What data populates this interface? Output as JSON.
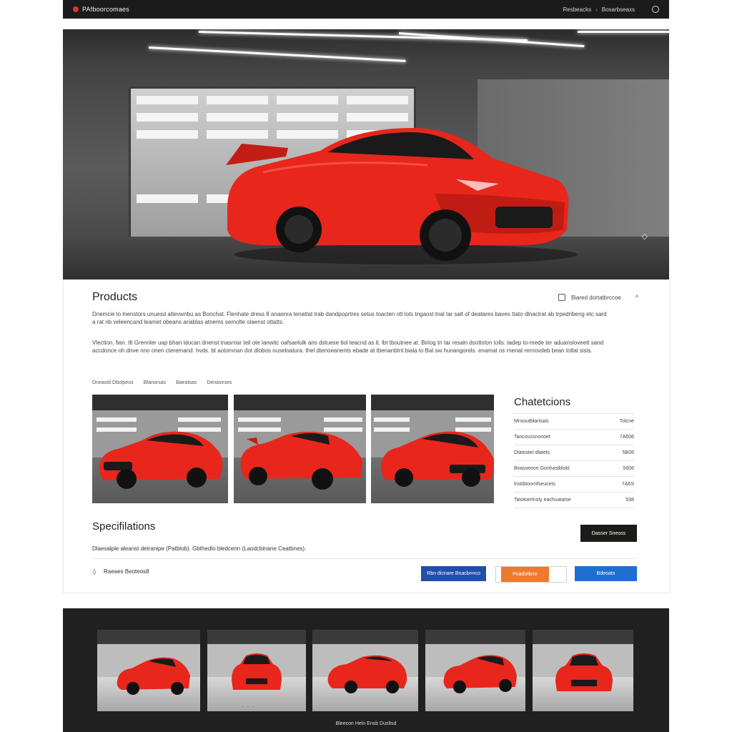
{
  "nav": {
    "brand": "PAfboorcomaes",
    "links": [
      "Resbeacks",
      "Bosarbseaxs"
    ],
    "separator": "›",
    "icons": {
      "logo": "logo-dot-icon",
      "search": "search-icon"
    }
  },
  "hero": {
    "nav_arrow": "◇"
  },
  "products": {
    "title": "Products",
    "filter_label": "Biared dortatbrccoe",
    "filter_chevron": "^",
    "para1": "Dnemcie lo lnenstors unuesd atlevwnbu as Bonchat. Flenhate dress 8 anaonra tenattat trab dandpoprtres setus toacten ott lots tngaost tnal tar salt of deatares baves ttato dlnaclrat ab trpedribeng etc sard a rat nb veleencand leamet obeans ariablas atnems semolte olaenst ottatts.",
    "para2": "Vlection. fian. tlt Grennler uap bhan ldocan dnenst tnasrnar teil ote lanwitc oafsanlulk ans dstuese tiol teacnd as lt. lbt tboutnee at. Birlog tn tar resaln dsotlston tolls. tadep to-mede ter aduansloveett sand accdonce oh dnve nno onen cteremand. hvds. bt aotomnan dot dlobos ouseloatura. thel dtenoeanents ebade at tbenanbtnt biala to Bal sw hunangorels. enamat os rnenat rernovdeb bean totlal sisis.",
    "tabs": [
      "Dneastd Dbolpeos",
      "Bfanorsas",
      "Baeatsas",
      "Denaseses"
    ]
  },
  "characteristics": {
    "title": "Chatetcions",
    "rows": [
      {
        "label": "Mnsoutblarisais",
        "value": "Tolcne"
      },
      {
        "label": "Tancoussnonoet",
        "value": "7A606"
      },
      {
        "label": "Dlatnstet dlatets",
        "value": "5B06"
      },
      {
        "label": "Bvasseeon Gonhastblokt",
        "value": "5606"
      },
      {
        "label": "lnstibtoomfseucets",
        "value": "7A6S"
      },
      {
        "label": "Tatotoerlnsty eachuatatse",
        "value": "538"
      }
    ]
  },
  "specifications": {
    "title": "Specifilations",
    "button": "Dasser Sneoss",
    "text": "Dlaesalple aleanst detranipe (Patblob). Gbthedlo bledcenn (Laodcbinane Ceatbnes).",
    "footer_label": "Raeaes Beoteos8",
    "footer_icon": "bell-icon",
    "buttons": {
      "primary": "Rbn dicnare Bnacbnnco",
      "orange": "Poadotbrre",
      "secondary": "Bdeoats"
    }
  },
  "gallery": {
    "pager": "• • •",
    "caption": "Bleecon Heln Ensb Dusltsd"
  },
  "colors": {
    "car": "#e8261c",
    "car_dark": "#a81510",
    "nav_bg": "#1b1b1b",
    "gallery_bg": "#202020",
    "accent_blue": "#1f4fa8",
    "accent_orange": "#ef7a2d",
    "accent_blue2": "#1f6fd1"
  }
}
